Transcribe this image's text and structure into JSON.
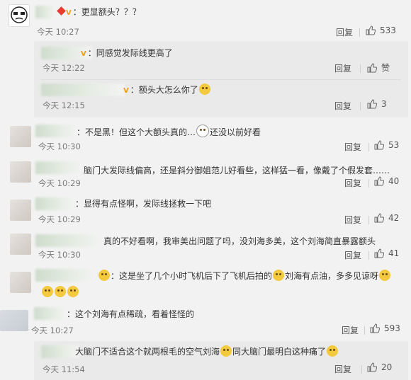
{
  "ui": {
    "reply_label": "回复",
    "zan_label": "赞"
  },
  "comments": [
    {
      "name": "",
      "text": "：更显额头？？？",
      "time": "今天 10:27",
      "likes": "533"
    },
    {
      "name": "",
      "text": "：同感觉发际线更高了",
      "time": "今天 12:22",
      "likes": "赞"
    },
    {
      "name": "",
      "text": "：额头大怎么你了",
      "time": "今天 12:15",
      "likes": "3"
    },
    {
      "name": "",
      "text": "：不是黑！但这个大额头真的…",
      "text2": "还没以前好看",
      "time": "今天 10:30",
      "likes": "53"
    },
    {
      "name": "",
      "text": "脑门大发际线偏高，还是斜分御姐范儿好看些，这样猛一看，像戴了个假发套……",
      "time": "今天 10:29",
      "likes": "40"
    },
    {
      "name": "",
      "text": "：显得有点怪啊，发际线拯救一下吧",
      "time": "今天 10:29",
      "likes": "42"
    },
    {
      "name": "",
      "text": "真的不好看啊，我审美出问题了吗，没刘海多美，这个刘海简直暴露额头",
      "time": "今天 10:30",
      "likes": "41"
    },
    {
      "name": "",
      "text": "：这是坐了几个小时飞机后下了飞机后拍的",
      "text2": "刘海有点油，多多见谅呀",
      "time": "",
      "likes": ""
    },
    {
      "name": "",
      "text": "：这个刘海有点稀疏，看着怪怪的",
      "time": "今天 10:27",
      "likes": "593"
    },
    {
      "name": "",
      "text": "大脑门不适合这个就两根毛的空气刘海",
      "text2": "同大脑门最明白这种痛了",
      "time": "今天 11:54",
      "likes": "20"
    }
  ]
}
